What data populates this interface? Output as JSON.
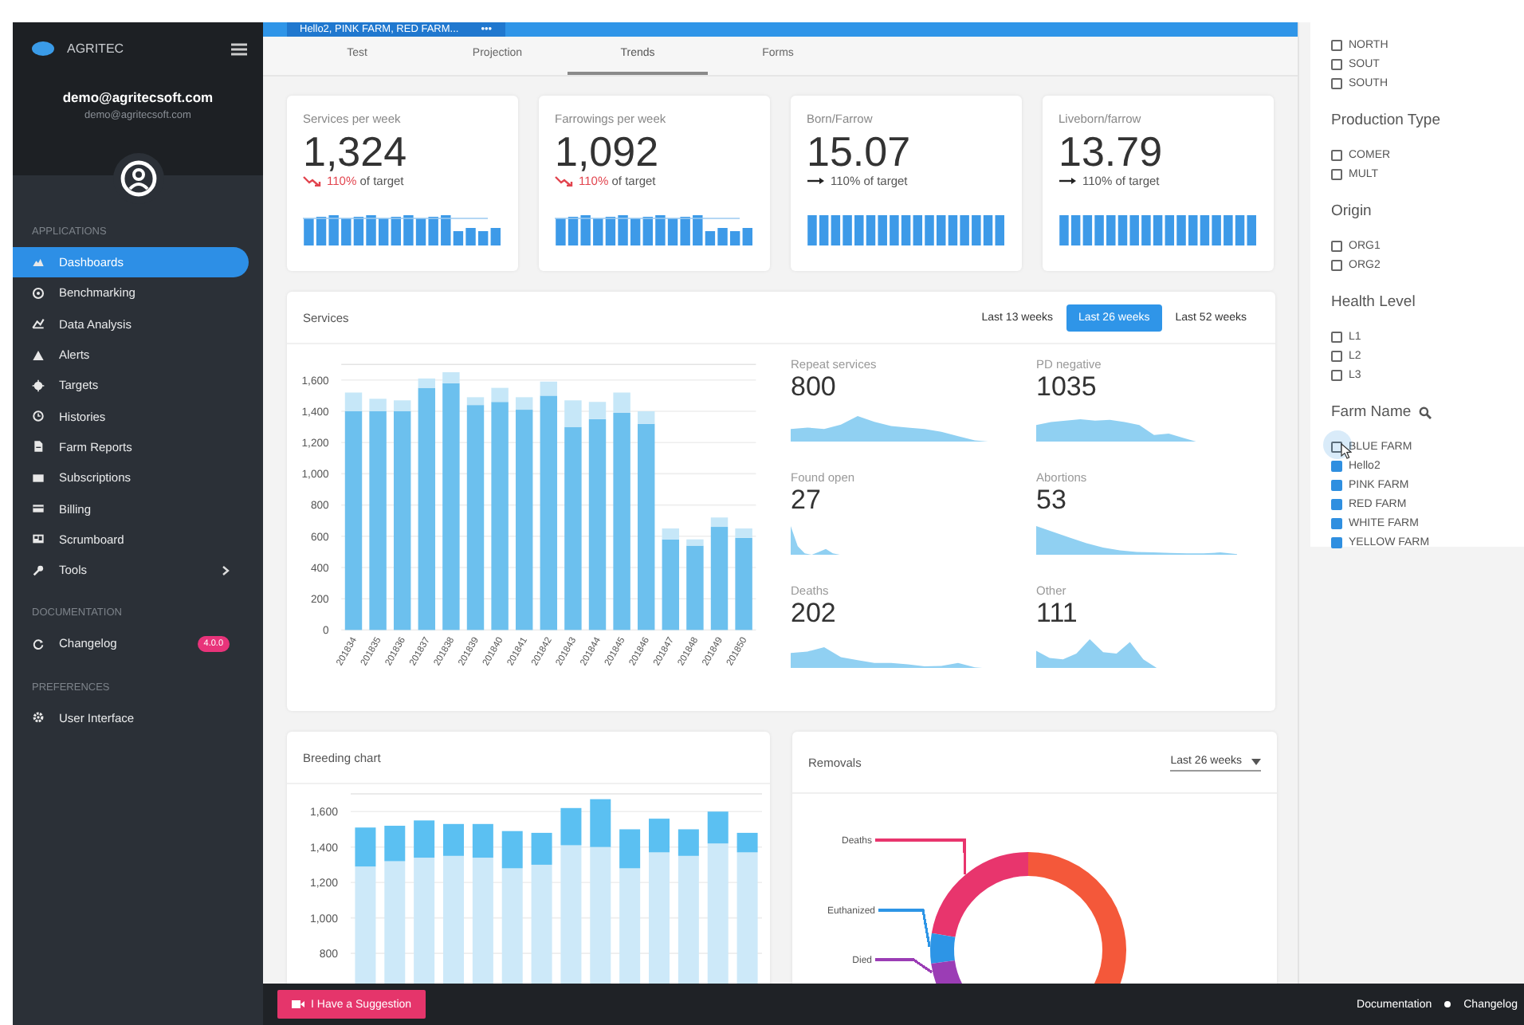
{
  "sidebar": {
    "brand": "AGRITEC",
    "user_name": "demo@agritecsoft.com",
    "user_email": "demo@agritecsoft.com",
    "sections": [
      {
        "title": "APPLICATIONS",
        "items": [
          {
            "label": "Dashboards",
            "selected": true,
            "submenu": false
          },
          {
            "label": "Benchmarking",
            "selected": false,
            "submenu": false
          },
          {
            "label": "Data Analysis",
            "selected": false,
            "submenu": false
          },
          {
            "label": "Alerts",
            "selected": false,
            "submenu": false
          },
          {
            "label": "Targets",
            "selected": false,
            "submenu": false
          },
          {
            "label": "Histories",
            "selected": false,
            "submenu": false
          },
          {
            "label": "Farm Reports",
            "selected": false,
            "submenu": false
          },
          {
            "label": "Subscriptions",
            "selected": false,
            "submenu": false
          },
          {
            "label": "Billing",
            "selected": false,
            "submenu": false
          },
          {
            "label": "Scrumboard",
            "selected": false,
            "submenu": false
          },
          {
            "label": "Tools",
            "selected": false,
            "submenu": true
          }
        ]
      },
      {
        "title": "DOCUMENTATION",
        "items": [
          {
            "label": "Changelog",
            "selected": false,
            "submenu": false,
            "badge": "4.0.0"
          }
        ]
      },
      {
        "title": "PREFERENCES",
        "items": [
          {
            "label": "User Interface",
            "selected": false,
            "submenu": false
          }
        ]
      }
    ]
  },
  "top_bar": {
    "filter_chip": "Hello2, PINK FARM, RED FARM...",
    "more": "•••"
  },
  "tabs": [
    {
      "label": "Test",
      "selected": false
    },
    {
      "label": "Projection",
      "selected": false
    },
    {
      "label": "Trends",
      "selected": true
    },
    {
      "label": "Forms",
      "selected": false
    }
  ],
  "kpis": [
    {
      "label": "Services per week",
      "value": "1,324",
      "kind": "down",
      "target_value": "110%",
      "target_text": "of target"
    },
    {
      "label": "Farrowings per week",
      "value": "1,092",
      "kind": "down",
      "target_value": "110%",
      "target_text": "of target"
    },
    {
      "label": "Born/Farrow",
      "value": "15.07",
      "kind": "flat",
      "target_value": "110%",
      "target_text": "of target"
    },
    {
      "label": "Liveborn/farrow",
      "value": "13.79",
      "kind": "flat",
      "target_value": "110%",
      "target_text": "of target"
    }
  ],
  "services": {
    "title": "Services",
    "ranges": [
      {
        "label": "Last 13 weeks",
        "selected": false
      },
      {
        "label": "Last 26 weeks",
        "selected": true
      },
      {
        "label": "Last 52 weeks",
        "selected": false
      }
    ],
    "chart_data": {
      "type": "bar",
      "stacked": true,
      "grid": true,
      "ylim": [
        0,
        1700
      ],
      "categories": [
        "201834",
        "201835",
        "201836",
        "201837",
        "201838",
        "201839",
        "201840",
        "201841",
        "201842",
        "201843",
        "201844",
        "201845",
        "201846",
        "201847",
        "201848",
        "201849",
        "201850"
      ],
      "yticks": [
        0,
        200,
        400,
        600,
        800,
        {
          "value": 1000,
          "label": "1,000"
        },
        {
          "value": 1200,
          "label": "1,200"
        },
        {
          "value": 1400,
          "label": "1,400"
        },
        {
          "value": 1600,
          "label": "1,600"
        }
      ],
      "series": [
        {
          "color": "#6cc0ee",
          "values": [
            1400,
            1400,
            1400,
            1550,
            1580,
            1440,
            1460,
            1410,
            1500,
            1300,
            1350,
            1390,
            1320,
            580,
            540,
            660,
            590
          ]
        },
        {
          "color": "#c6e7f8",
          "values": [
            120,
            80,
            70,
            60,
            70,
            50,
            90,
            80,
            90,
            170,
            110,
            130,
            80,
            70,
            40,
            60,
            60
          ]
        }
      ]
    },
    "metrics": [
      {
        "label": "Repeat services",
        "value": "800"
      },
      {
        "label": "PD negative",
        "value": "1035"
      },
      {
        "label": "Found open",
        "value": "27"
      },
      {
        "label": "Abortions",
        "value": "53"
      },
      {
        "label": "Deaths",
        "value": "202"
      },
      {
        "label": "Other",
        "value": "111"
      }
    ]
  },
  "breeding": {
    "title": "Breeding chart",
    "chart_data": {
      "type": "bar",
      "stacked": true,
      "grid": true,
      "ylim": [
        0,
        1700
      ],
      "yticks": [
        800,
        {
          "value": 1000,
          "label": "1,000"
        },
        {
          "value": 1200,
          "label": "1,200"
        },
        {
          "value": 1400,
          "label": "1,400"
        },
        {
          "value": 1600,
          "label": "1,600"
        }
      ],
      "series": [
        {
          "color": "#cde9f9",
          "values": [
            1290,
            1320,
            1340,
            1350,
            1340,
            1280,
            1300,
            1410,
            1400,
            1280,
            1370,
            1350,
            1420,
            1370
          ]
        },
        {
          "color": "#5bc0f2",
          "values": [
            220,
            200,
            210,
            180,
            190,
            210,
            180,
            210,
            270,
            220,
            190,
            150,
            180,
            110
          ]
        }
      ]
    }
  },
  "removals": {
    "title": "Removals",
    "range": "Last 26 weeks",
    "segments": [
      {
        "label": "Deaths",
        "color": "#e8356d"
      },
      {
        "label": "Euthanized",
        "color": "#2d95e6"
      },
      {
        "label": "Died",
        "color": "#9b3db5"
      }
    ]
  },
  "filters": {
    "groups": [
      {
        "options": [
          {
            "label": "NORTH",
            "checked": false,
            "hovered": false
          },
          {
            "label": "SOUT",
            "checked": false,
            "hovered": false
          },
          {
            "label": "SOUTH",
            "checked": false,
            "hovered": false
          }
        ]
      },
      {
        "title": "Production Type",
        "options": [
          {
            "label": "COMER",
            "checked": false,
            "hovered": false
          },
          {
            "label": "MULT",
            "checked": false,
            "hovered": false
          }
        ]
      },
      {
        "title": "Origin",
        "options": [
          {
            "label": "ORG1",
            "checked": false,
            "hovered": false
          },
          {
            "label": "ORG2",
            "checked": false,
            "hovered": false
          }
        ]
      },
      {
        "title": "Health Level",
        "options": [
          {
            "label": "L1",
            "checked": false,
            "hovered": false
          },
          {
            "label": "L2",
            "checked": false,
            "hovered": false
          },
          {
            "label": "L3",
            "checked": false,
            "hovered": false
          }
        ]
      },
      {
        "title": "Farm Name",
        "searchable": true,
        "options": [
          {
            "label": "BLUE FARM",
            "checked": false,
            "hovered": true
          },
          {
            "label": "Hello2",
            "checked": true,
            "hovered": false
          },
          {
            "label": "PINK FARM",
            "checked": true,
            "hovered": false
          },
          {
            "label": "RED FARM",
            "checked": true,
            "hovered": false
          },
          {
            "label": "WHITE FARM",
            "checked": true,
            "hovered": false
          },
          {
            "label": "YELLOW FARM",
            "checked": true,
            "hovered": false
          }
        ]
      }
    ]
  },
  "footer": {
    "suggestion": "I Have a Suggestion",
    "links": [
      "Documentation",
      "Changelog"
    ]
  }
}
